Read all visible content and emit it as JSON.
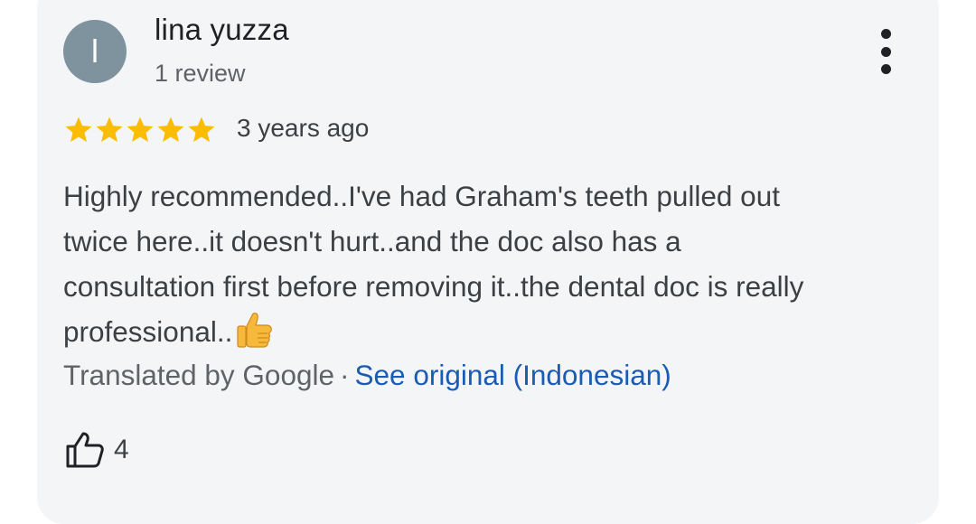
{
  "review": {
    "author": {
      "name": "lina yuzza",
      "initial": "l",
      "review_count": "1 review",
      "avatar_color": "#7e939d"
    },
    "rating": 5,
    "rating_max": 5,
    "star_color": "#fbbc04",
    "date": "3 years ago",
    "text_lines": [
      "Highly recommended..I've had Graham's teeth pulled out",
      "twice here..it doesn't hurt..and the doc also has a",
      "consultation first before removing it..the dental doc is really",
      "professional.."
    ],
    "emoji": "thumbs-up",
    "translation": {
      "by": "Translated by Google",
      "separator": "·",
      "link": "See original (Indonesian)"
    },
    "likes": "4",
    "more_icon": "more-vertical-icon",
    "like_icon": "thumbs-up-outline-icon"
  }
}
